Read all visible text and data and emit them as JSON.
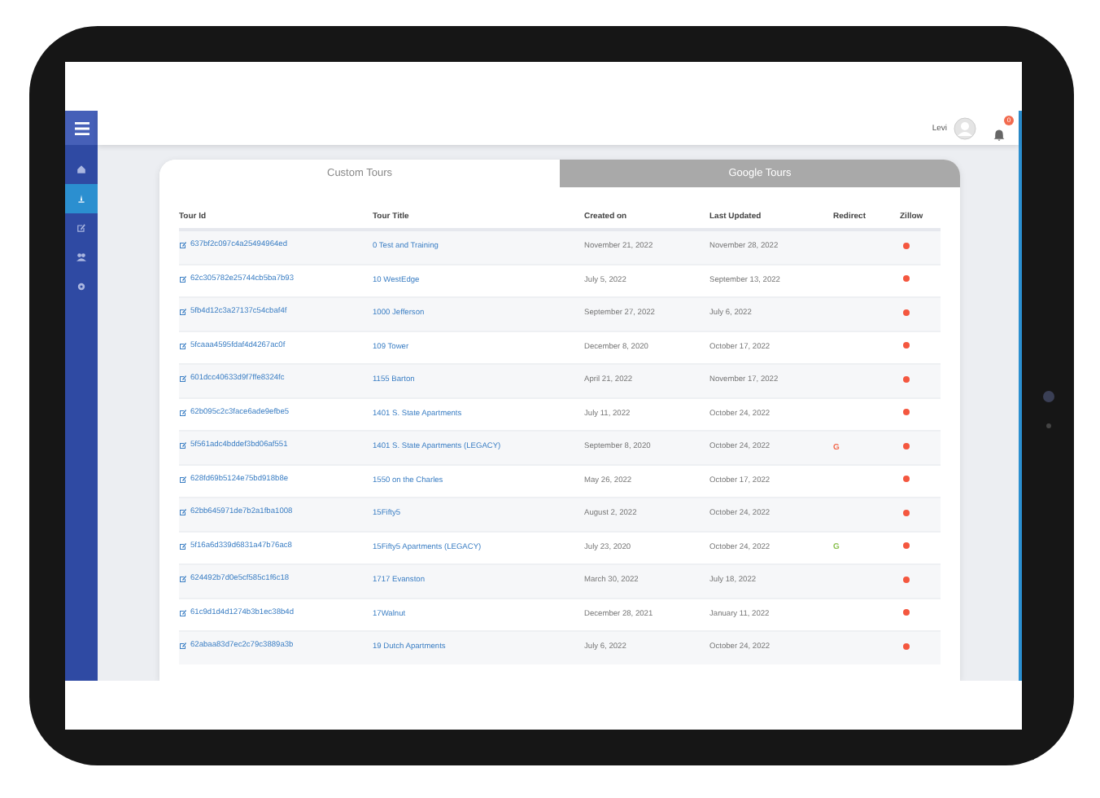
{
  "header": {
    "user_name": "Levi",
    "notification_count": "0"
  },
  "sidebar": {
    "items": [
      {
        "selected": false
      },
      {
        "selected": true
      },
      {
        "selected": false
      },
      {
        "selected": false
      },
      {
        "selected": false
      }
    ]
  },
  "tabs": [
    {
      "label": "Custom Tours",
      "selected": true
    },
    {
      "label": "Google Tours",
      "selected": false
    }
  ],
  "table": {
    "columns": [
      "Tour Id",
      "Tour Title",
      "Created on",
      "Last Updated",
      "Redirect",
      "Zillow"
    ],
    "rows": [
      {
        "id": "637bf2c097c4a25494964ed",
        "title": "0 Test and Training",
        "created": "November 21, 2022",
        "updated": "November 28, 2022"
      },
      {
        "id": "62c305782e25744cb5ba7b93",
        "title": "10 WestEdge",
        "created": "July 5, 2022",
        "updated": "September 13, 2022"
      },
      {
        "id": "5fb4d12c3a27137c54cbaf4f",
        "title": "1000 Jefferson",
        "created": "September 27, 2022",
        "updated": "July 6, 2022"
      },
      {
        "id": "5fcaaa4595fdaf4d4267ac0f",
        "title": "109 Tower",
        "created": "December 8, 2020",
        "updated": "October 17, 2022"
      },
      {
        "id": "601dcc40633d9f7ffe8324fc",
        "title": "1155 Barton",
        "created": "April 21, 2022",
        "updated": "November 17, 2022"
      },
      {
        "id": "62b095c2c3face6ade9efbe5",
        "title": "1401 S. State Apartments",
        "created": "July 11, 2022",
        "updated": "October 24, 2022"
      },
      {
        "id": "5f561adc4bddef3bd06af551",
        "title": "1401 S. State Apartments (LEGACY)",
        "created": "September 8, 2020",
        "updated": "October 24, 2022",
        "redirect": {
          "text": "G",
          "color": "#f26b4f"
        }
      },
      {
        "id": "628fd69b5124e75bd918b8e",
        "title": "1550 on the Charles",
        "created": "May 26, 2022",
        "updated": "October 17, 2022"
      },
      {
        "id": "62bb645971de7b2a1fba1008",
        "title": "15Fifty5",
        "created": "August 2, 2022",
        "updated": "October 24, 2022"
      },
      {
        "id": "5f16a6d339d6831a47b76ac8",
        "title": "15Fifty5 Apartments (LEGACY)",
        "created": "July 23, 2020",
        "updated": "October 24, 2022",
        "redirect": {
          "text": "G",
          "color": "#8cc152"
        }
      },
      {
        "id": "624492b7d0e5cf585c1f6c18",
        "title": "1717 Evanston",
        "created": "March 30, 2022",
        "updated": "July 18, 2022"
      },
      {
        "id": "61c9d1d4d1274b3b1ec38b4d",
        "title": "17Walnut",
        "created": "December 28, 2021",
        "updated": "January 11, 2022"
      },
      {
        "id": "62abaa83d7ec2c79c3889a3b",
        "title": "19 Dutch Apartments",
        "created": "July 6, 2022",
        "updated": "October 24, 2022"
      }
    ]
  }
}
